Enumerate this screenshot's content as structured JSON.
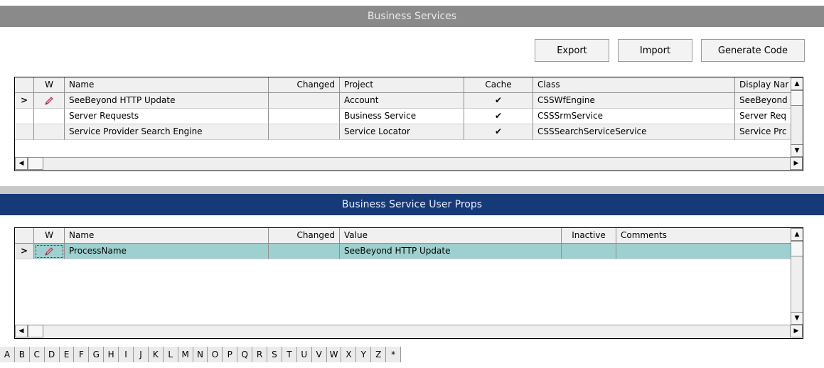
{
  "business_services": {
    "title": "Business Services",
    "buttons": {
      "export": "Export",
      "import": "Import",
      "generate_code": "Generate Code"
    },
    "columns": [
      "W",
      "Name",
      "Changed",
      "Project",
      "Cache",
      "Class",
      "Display Nar"
    ],
    "rows": [
      {
        "name": "SeeBeyond HTTP Update",
        "project": "Account",
        "cache": "✔",
        "class": "CSSWfEngine",
        "display_name": "SeeBeyond",
        "selected": true,
        "edit_icon": "pencil-icon"
      },
      {
        "name": "Server Requests",
        "project": "Business Service",
        "cache": "✔",
        "class": "CSSSrmService",
        "display_name": "Server Req"
      },
      {
        "name": "Service Provider Search Engine",
        "project": "Service Locator",
        "cache": "✔",
        "class": "CSSSearchServiceService",
        "display_name": "Service Prc"
      }
    ]
  },
  "user_props": {
    "title": "Business Service User Props",
    "columns": [
      "W",
      "Name",
      "Changed",
      "Value",
      "Inactive",
      "Comments"
    ],
    "rows": [
      {
        "name": "ProcessName",
        "value": "SeeBeyond HTTP Update",
        "selected": true,
        "edit_icon": "pencil-icon"
      }
    ]
  },
  "alpha_bar": [
    "A",
    "B",
    "C",
    "D",
    "E",
    "F",
    "G",
    "H",
    "I",
    "J",
    "K",
    "L",
    "M",
    "N",
    "O",
    "P",
    "Q",
    "R",
    "S",
    "T",
    "U",
    "V",
    "W",
    "X",
    "Y",
    "Z",
    "*"
  ],
  "colors": {
    "bs_title_bg": "#8a8a8a",
    "up_title_bg": "#163a78",
    "selected_row": "#9fd0d0"
  }
}
